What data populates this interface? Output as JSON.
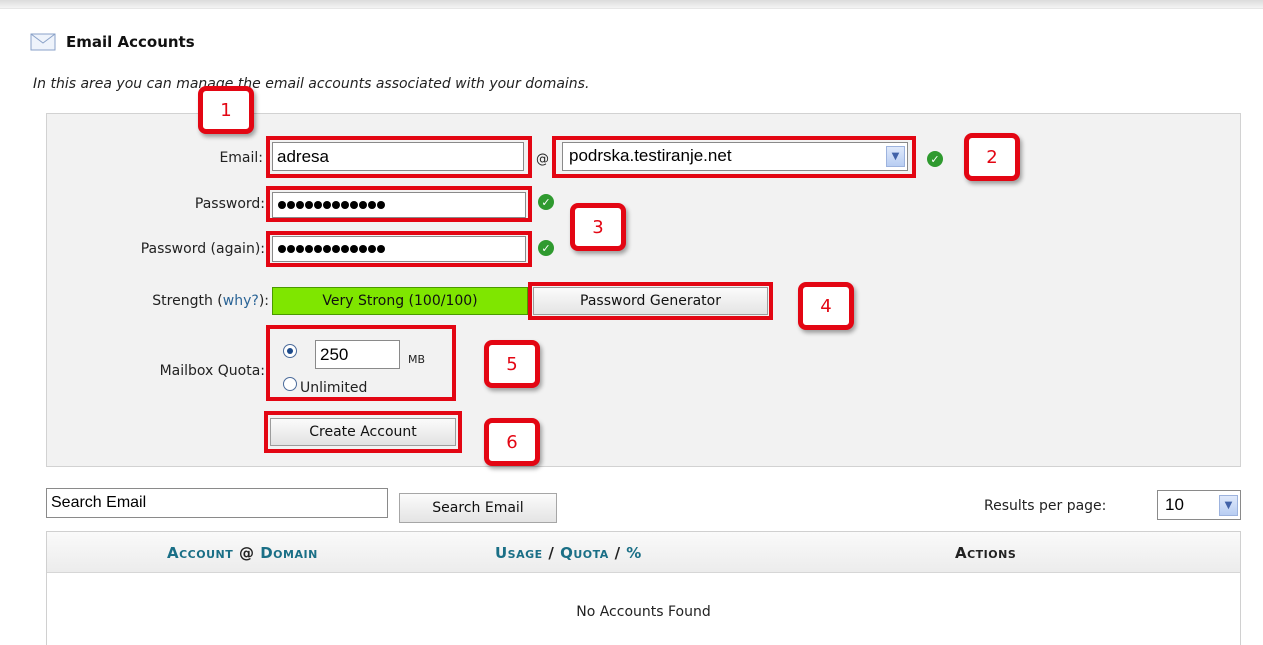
{
  "header": {
    "icon": "envelope-icon",
    "title": "Email Accounts",
    "intro": "In this area you can manage the email accounts associated with your domains."
  },
  "form": {
    "email_label": "Email:",
    "email_value": "adresa",
    "at_sign": "@",
    "domain_value": "podrska.testiranje.net",
    "password_label": "Password:",
    "password_again_label": "Password (again):",
    "password_masked_length": 12,
    "strength_label_prefix": "Strength (",
    "strength_why_link": "why?",
    "strength_label_suffix": "):",
    "strength_value": "Very Strong (100/100)",
    "strength_color": "#7fe600",
    "password_generator_button": "Password Generator",
    "quota_label": "Mailbox Quota:",
    "quota_value": "250",
    "quota_unit": "MB",
    "quota_selected": "limited",
    "unlimited_label": "Unlimited",
    "create_button": "Create Account"
  },
  "annotations": [
    "1",
    "2",
    "3",
    "4",
    "5",
    "6"
  ],
  "search": {
    "placeholder": "Search Email",
    "value": "Search Email",
    "button": "Search Email",
    "results_per_page_label": "Results per page:",
    "results_per_page_value": "10"
  },
  "table": {
    "col_account": "Account",
    "col_at": "@",
    "col_domain": "Domain",
    "col_usage": "Usage",
    "col_slash1": "/",
    "col_quota": "Quota",
    "col_slash2": "/",
    "col_percent": "%",
    "col_actions": "Actions",
    "empty_message": "No Accounts Found"
  },
  "colors": {
    "highlight_red": "#e30613",
    "check_green": "#2f9a2f",
    "link_teal": "#1a6f86"
  }
}
